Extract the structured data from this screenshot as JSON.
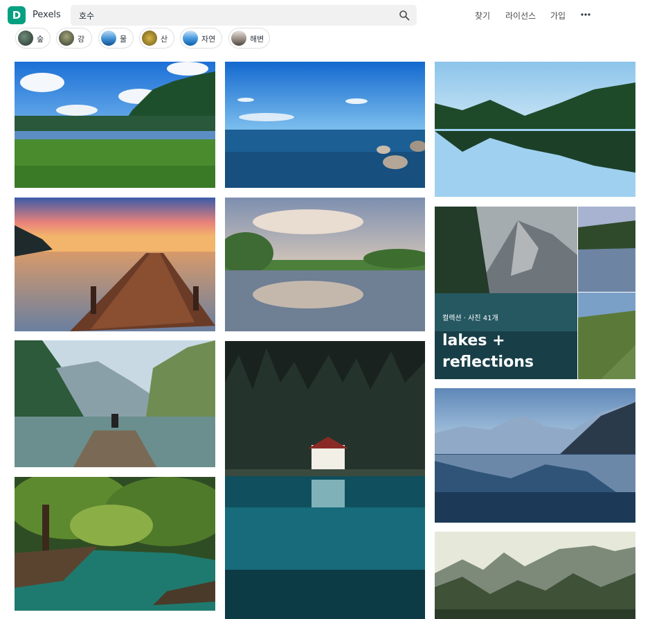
{
  "header": {
    "brand": "Pexels",
    "search": {
      "value": "호수"
    },
    "nav": {
      "explore": "찾기",
      "license": "라이선스",
      "join": "가입"
    }
  },
  "chips": [
    {
      "label": "숲"
    },
    {
      "label": "강"
    },
    {
      "label": "물"
    },
    {
      "label": "산"
    },
    {
      "label": "자연"
    },
    {
      "label": "해변"
    }
  ],
  "collection": {
    "meta": "컬렉션 · 사진 41개",
    "title": "lakes + reflections"
  },
  "icons": {
    "logo": "pexels-logo-icon",
    "search": "search-icon",
    "more": "more-dots-icon"
  },
  "colors": {
    "brand": "#05a081",
    "search_bg": "#f1f1f1"
  }
}
